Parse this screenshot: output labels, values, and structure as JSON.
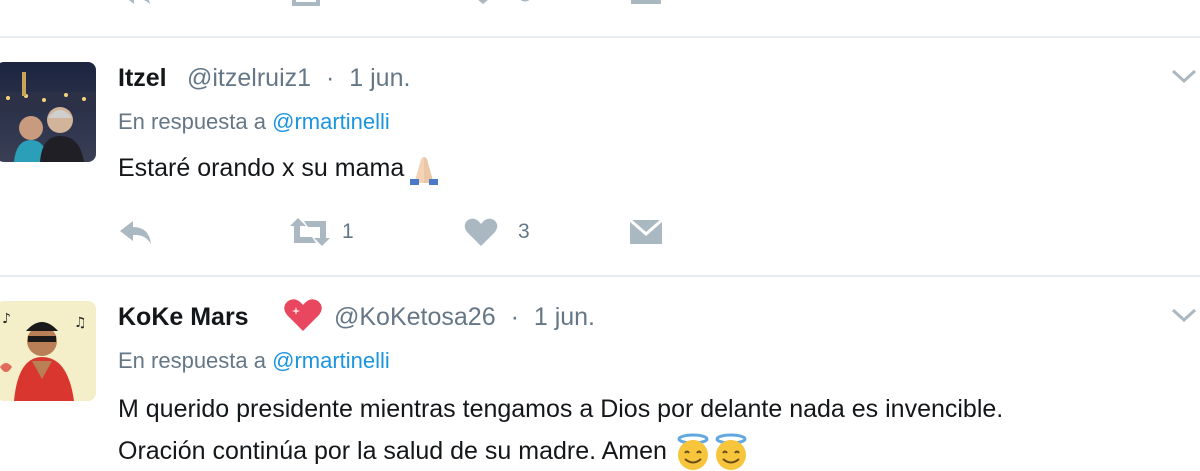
{
  "colors": {
    "text": "#14171a",
    "muted": "#657786",
    "link": "#1b95e0",
    "divider": "#e6ecf0",
    "icon": "#aab8c2"
  },
  "tweets": [
    {
      "name": "Itzel",
      "handle": "@itzelruiz1",
      "separator": "·",
      "date": "1 jun.",
      "reply_prefix": "En respuesta a",
      "reply_to": "@rmartinelli",
      "text": "Estaré orando x su mama",
      "retweets": "1",
      "likes": "3",
      "icons": [
        "reply-icon",
        "retweet-icon",
        "heart-icon",
        "message-icon",
        "chevron-down-icon",
        "folded-hands-emoji"
      ]
    },
    {
      "name": "KoKe Mars",
      "handle": "@KoKetosa26",
      "separator": "·",
      "date": "1 jun.",
      "reply_prefix": "En respuesta a",
      "reply_to": "@rmartinelli",
      "text_line1": "M querido presidente mientras tengamos a Dios por delante nada es invencible.",
      "text_line2": "Oración continúa por la salud de su madre. Amen",
      "icons": [
        "sparkling-heart-emoji",
        "smiling-face-with-halo-emoji",
        "chevron-down-icon"
      ]
    }
  ]
}
